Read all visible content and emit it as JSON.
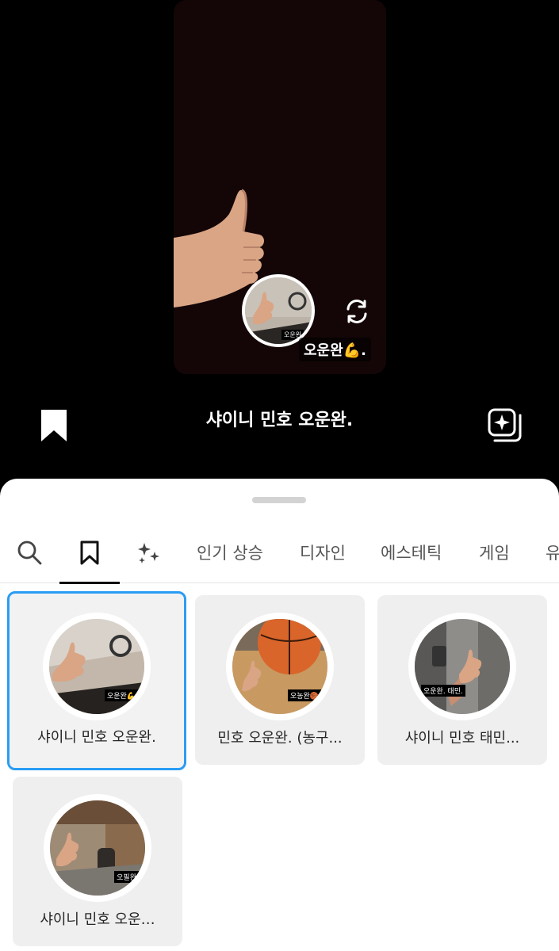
{
  "preview": {
    "circle_tag": "오운완",
    "caption": "오운완💪."
  },
  "effect": {
    "title": "샤이니 민호 오운완."
  },
  "tabs": {
    "items": [
      {
        "label": "인기 상승"
      },
      {
        "label": "디자인"
      },
      {
        "label": "에스테틱"
      },
      {
        "label": "게임"
      },
      {
        "label": "유"
      }
    ]
  },
  "cards": [
    {
      "label": "샤이니 민호 오운완.",
      "tag": "오운완💪"
    },
    {
      "label": "민호 오운완. (농구...",
      "tag": "오농완🏀"
    },
    {
      "label": "샤이니 민호 태민...",
      "tag": "오운완. 태민."
    },
    {
      "label": "샤이니 민호 오운…",
      "tag": "오필완"
    }
  ],
  "colors": {
    "selected_border": "#2a9df4",
    "sheet_bg": "#ffffff",
    "card_bg": "#efefef"
  }
}
